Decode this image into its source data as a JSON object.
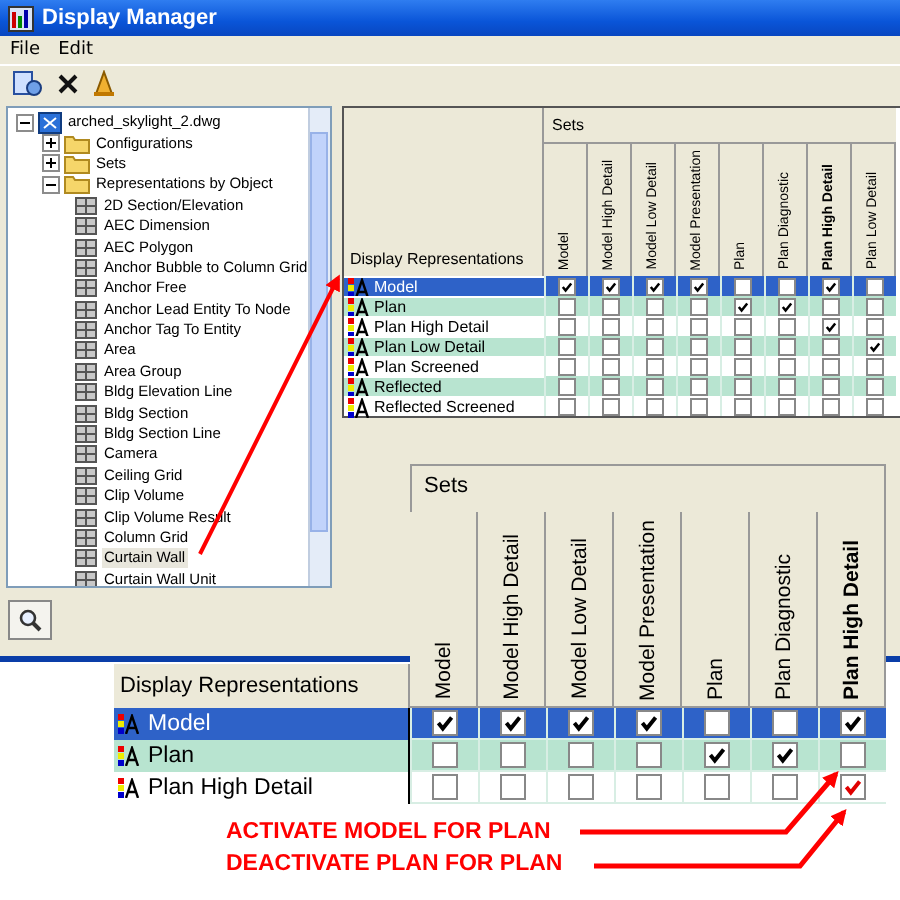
{
  "window": {
    "title": "Display Manager"
  },
  "menu": [
    "File",
    "Edit"
  ],
  "tree": {
    "label": "arched_skylight_2.dwg",
    "expanded": true,
    "children": [
      {
        "label": "Configurations",
        "expanded": false
      },
      {
        "label": "Sets",
        "expanded": false
      },
      {
        "label": "Representations by Object",
        "expanded": true,
        "children": [
          {
            "label": "2D Section/Elevation",
            "selected": false
          },
          {
            "label": "AEC Dimension",
            "selected": false
          },
          {
            "label": "AEC Polygon",
            "selected": false
          },
          {
            "label": "Anchor Bubble to Column Grid",
            "selected": false
          },
          {
            "label": "Anchor Free",
            "selected": false
          },
          {
            "label": "Anchor Lead Entity To Node",
            "selected": false
          },
          {
            "label": "Anchor Tag To Entity",
            "selected": false
          },
          {
            "label": "Area",
            "selected": false
          },
          {
            "label": "Area Group",
            "selected": false
          },
          {
            "label": "Bldg Elevation Line",
            "selected": false
          },
          {
            "label": "Bldg Section",
            "selected": false
          },
          {
            "label": "Bldg Section Line",
            "selected": false
          },
          {
            "label": "Camera",
            "selected": false
          },
          {
            "label": "Ceiling Grid",
            "selected": false
          },
          {
            "label": "Clip Volume",
            "selected": false
          },
          {
            "label": "Clip Volume Result",
            "selected": false
          },
          {
            "label": "Column Grid",
            "selected": false
          },
          {
            "label": "Curtain Wall",
            "selected": true
          },
          {
            "label": "Curtain Wall Unit",
            "selected": false
          }
        ]
      }
    ]
  },
  "table": {
    "group_header": "Sets",
    "name_header": "Display Representations",
    "columns": [
      {
        "label": "Model",
        "bold": false
      },
      {
        "label": "Model High Detail",
        "bold": false
      },
      {
        "label": "Model Low Detail",
        "bold": false
      },
      {
        "label": "Model Presentation",
        "bold": false
      },
      {
        "label": "Plan",
        "bold": false
      },
      {
        "label": "Plan Diagnostic",
        "bold": false
      },
      {
        "label": "Plan High Detail",
        "bold": true
      },
      {
        "label": "Plan Low Detail",
        "bold": false
      }
    ],
    "rows": [
      {
        "name": "Model",
        "selected": true,
        "checks": [
          true,
          true,
          true,
          true,
          false,
          false,
          true,
          false
        ]
      },
      {
        "name": "Plan",
        "selected": false,
        "checks": [
          false,
          false,
          false,
          false,
          true,
          true,
          false,
          false
        ]
      },
      {
        "name": "Plan High Detail",
        "selected": false,
        "checks": [
          false,
          false,
          false,
          false,
          false,
          false,
          true,
          false
        ]
      },
      {
        "name": "Plan Low Detail",
        "selected": false,
        "checks": [
          false,
          false,
          false,
          false,
          false,
          false,
          false,
          true
        ]
      },
      {
        "name": "Plan Screened",
        "selected": false,
        "checks": [
          false,
          false,
          false,
          false,
          false,
          false,
          false,
          false
        ]
      },
      {
        "name": "Reflected",
        "selected": false,
        "checks": [
          false,
          false,
          false,
          false,
          false,
          false,
          false,
          false
        ]
      },
      {
        "name": "Reflected Screened",
        "selected": false,
        "checks": [
          false,
          false,
          false,
          false,
          false,
          false,
          false,
          false
        ]
      }
    ]
  },
  "inset": {
    "group_header": "Sets",
    "name_header": "Display Representations",
    "columns": [
      {
        "label": "Model",
        "bold": false
      },
      {
        "label": "Model High Detail",
        "bold": false
      },
      {
        "label": "Model Low Detail",
        "bold": false
      },
      {
        "label": "Model Presentation",
        "bold": false
      },
      {
        "label": "Plan",
        "bold": false
      },
      {
        "label": "Plan Diagnostic",
        "bold": false
      },
      {
        "label": "Plan High Detail",
        "bold": true
      }
    ],
    "rows": [
      {
        "name": "Model",
        "selected": true,
        "color": "#000000",
        "checks": [
          true,
          true,
          true,
          true,
          false,
          false,
          true
        ]
      },
      {
        "name": "Plan",
        "selected": false,
        "color": "#000000",
        "checks": [
          false,
          false,
          false,
          false,
          true,
          true,
          false
        ]
      },
      {
        "name": "Plan High Detail",
        "selected": false,
        "color": "#e00000",
        "checks": [
          false,
          false,
          false,
          false,
          false,
          false,
          true
        ]
      }
    ]
  },
  "annotations": [
    "ACTIVATE MODEL FOR PLAN",
    "DEACTIVATE PLAN FOR PLAN"
  ]
}
